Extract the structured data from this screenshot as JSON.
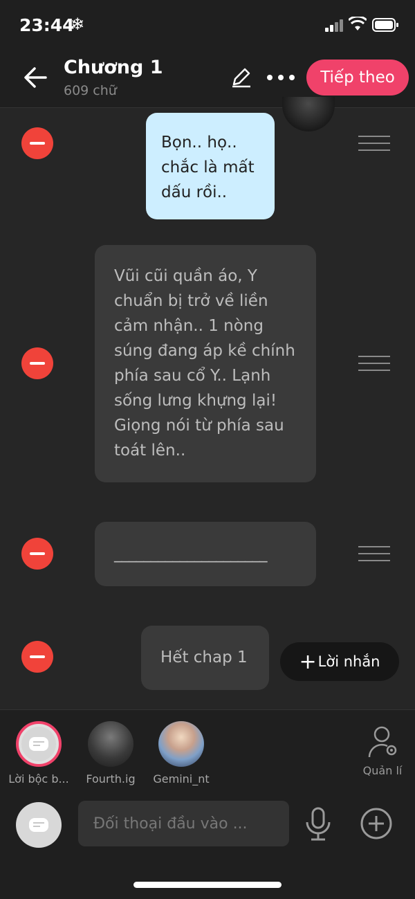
{
  "status_bar": {
    "time": "23:44",
    "snow_icon": "❄"
  },
  "header": {
    "title": "Chương 1",
    "subtitle": "609 chữ",
    "next_label": "Tiếp theo"
  },
  "messages": [
    {
      "text": "Bọn.. họ.. chắc là mất dấu rồi..",
      "style": "highlight"
    },
    {
      "text": "Vũi cũi quần áo, Y chuẩn bị trở về liền cảm nhận.. 1 nòng súng đang áp kề chính phía sau cổ Y.. Lạnh sống lưng khựng lại! Giọng nói từ phía sau toát lên..",
      "style": "narration"
    },
    {
      "text": "_____________________",
      "style": "narration"
    },
    {
      "text": "Hết chap 1",
      "style": "narration"
    }
  ],
  "note_button_label": "Lời nhắn",
  "characters": [
    {
      "name": "Lời bộc b..."
    },
    {
      "name": "Fourth.ig"
    },
    {
      "name": "Gemini_nt"
    }
  ],
  "manage_label": "Quản lí",
  "input": {
    "placeholder": "Đối thoại đầu vào ..."
  },
  "colors": {
    "accent": "#f0426a",
    "remove": "#f0433a",
    "highlight_bubble": "#cdeeff"
  },
  "icons": [
    "back-arrow-icon",
    "pencil-icon",
    "more-icon",
    "remove-icon",
    "drag-handle-icon",
    "plus-icon",
    "person-gear-icon",
    "message-icon",
    "microphone-icon",
    "add-circle-icon"
  ]
}
